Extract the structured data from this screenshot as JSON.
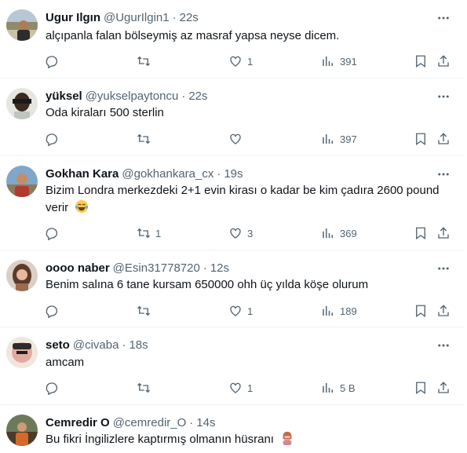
{
  "tweets": [
    {
      "name": "Ugur Ilgın",
      "handle": "@UgurIlgin1",
      "separator": "·",
      "time": "22s",
      "text": "alçıpanla falan bölseymiş az masraf yapsa neyse dicem.",
      "replies": "",
      "retweets": "",
      "likes": "1",
      "views": "391"
    },
    {
      "name": "yüksel",
      "handle": "@yukselpaytoncu",
      "separator": "·",
      "time": "22s",
      "text": "Oda kiraları 500 sterlin",
      "replies": "",
      "retweets": "",
      "likes": "",
      "views": "397"
    },
    {
      "name": "Gokhan Kara",
      "handle": "@gokhankara_cx",
      "separator": "·",
      "time": "19s",
      "text": "Bizim Londra merkezdeki 2+1 evin kirası o kadar be kim çadıra 2600 pound verir",
      "replies": "",
      "retweets": "1",
      "likes": "3",
      "views": "369",
      "emoji": "laughing-tears"
    },
    {
      "name": "oooo naber",
      "handle": "@Esin31778720",
      "separator": "·",
      "time": "12s",
      "text": "Benim salına 6 tane kursam 650000 ohh üç yılda köşe olurum",
      "replies": "",
      "retweets": "",
      "likes": "1",
      "views": "189"
    },
    {
      "name": "seto",
      "handle": "@civaba",
      "separator": "·",
      "time": "18s",
      "text": "amcam",
      "replies": "",
      "retweets": "",
      "likes": "1",
      "views": "5 B"
    },
    {
      "name": "Cemredir O",
      "handle": "@cemredir_O",
      "separator": "·",
      "time": "14s",
      "text": "Bu fikri İngilizlere kaptırmış olmanın hüsranı",
      "emoji": "facepalm-woman"
    }
  ],
  "colors": {
    "text": "#0f1419",
    "muted": "#536471",
    "border": "#eff3f4"
  },
  "icons": [
    "reply-icon",
    "retweet-icon",
    "like-icon",
    "views-icon",
    "bookmark-icon",
    "share-icon",
    "more-icon"
  ]
}
